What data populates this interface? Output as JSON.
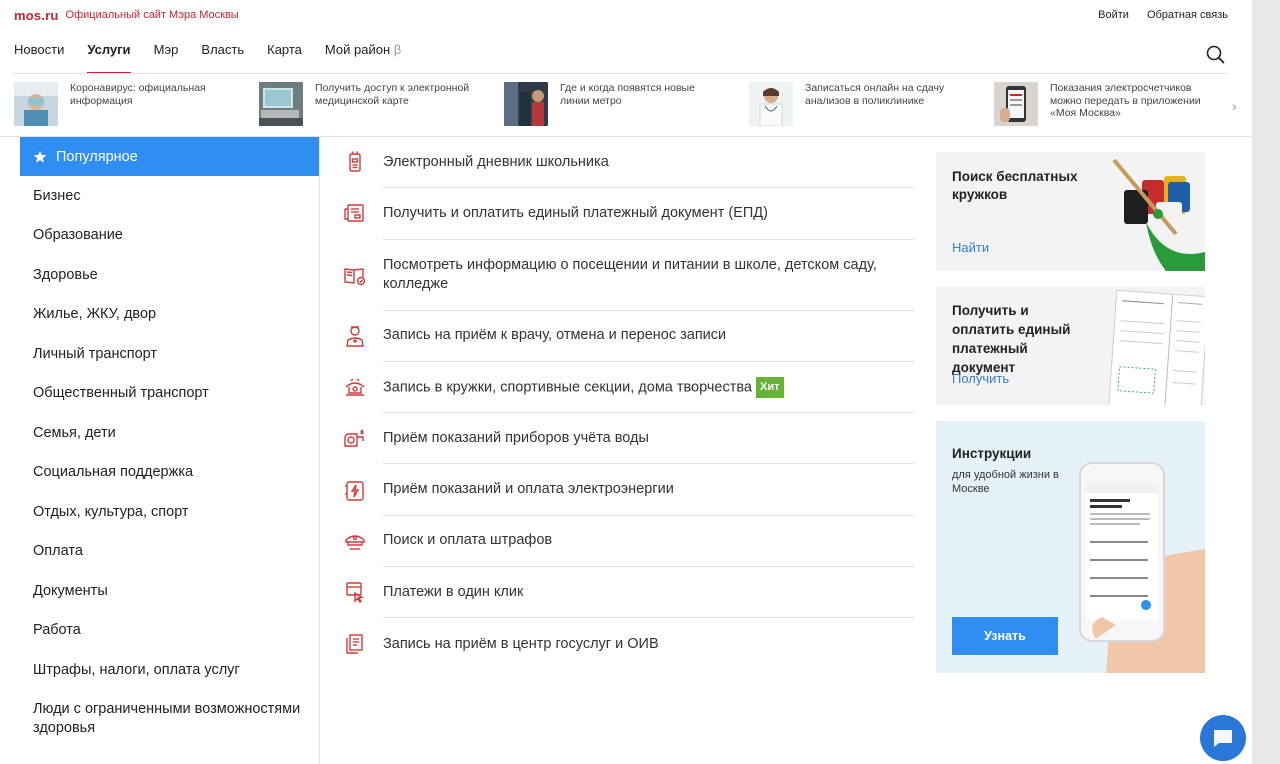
{
  "header": {
    "logo": "mos.ru",
    "tagline": "Официальный сайт Мэра Москвы",
    "login": "Войти",
    "feedback": "Обратная связь"
  },
  "nav": {
    "items": [
      {
        "label": "Новости"
      },
      {
        "label": "Услуги"
      },
      {
        "label": "Мэр"
      },
      {
        "label": "Власть"
      },
      {
        "label": "Карта"
      },
      {
        "label": "Мой район"
      }
    ],
    "beta": "β",
    "active": "Услуги"
  },
  "news": [
    {
      "text": "Коронавирус: официальная информация"
    },
    {
      "text": "Получить доступ к электронной медицинской карте"
    },
    {
      "text": "Где и когда появятся новые линии метро"
    },
    {
      "text": "Записаться онлайн на сдачу анализов в поликлинике"
    },
    {
      "text": "Показания электросчетчиков можно передать в приложении «Моя Москва»"
    }
  ],
  "sidebar": {
    "items": [
      {
        "label": "Популярное"
      },
      {
        "label": "Бизнес"
      },
      {
        "label": "Образование"
      },
      {
        "label": "Здоровье"
      },
      {
        "label": "Жилье, ЖКУ, двор"
      },
      {
        "label": "Личный транспорт"
      },
      {
        "label": "Общественный транспорт"
      },
      {
        "label": "Семья, дети"
      },
      {
        "label": "Социальная поддержка"
      },
      {
        "label": "Отдых, культура, спорт"
      },
      {
        "label": "Оплата"
      },
      {
        "label": "Документы"
      },
      {
        "label": "Работа"
      },
      {
        "label": "Штрафы, налоги, оплата услуг"
      },
      {
        "label": "Люди с ограниченными возможностями здоровья"
      }
    ]
  },
  "services": [
    {
      "label": "Электронный дневник школьника",
      "icon": "school-diary-icon"
    },
    {
      "label": "Получить и оплатить единый платежный документ (ЕПД)",
      "icon": "payment-document-icon"
    },
    {
      "label": "Посмотреть информацию о посещении и питании в школе, детском саду, колледже",
      "icon": "book-icon"
    },
    {
      "label": "Запись на приём к врачу, отмена и перенос записи",
      "icon": "doctor-icon"
    },
    {
      "label": "Запись в кружки, спортивные секции, дома творчества",
      "icon": "clubs-icon",
      "badge": "Хит"
    },
    {
      "label": "Приём показаний приборов учёта воды",
      "icon": "water-meter-icon"
    },
    {
      "label": "Приём показаний и оплата электроэнергии",
      "icon": "electricity-icon"
    },
    {
      "label": "Поиск и оплата штрафов",
      "icon": "police-cap-icon"
    },
    {
      "label": "Платежи в один клик",
      "icon": "one-click-payment-icon"
    },
    {
      "label": "Запись на приём в центр госуслуг и ОИВ",
      "icon": "documents-icon"
    }
  ],
  "cards": {
    "clubs": {
      "title": "Поиск бесплатных кружков",
      "link": "Найти"
    },
    "epd": {
      "title": "Получить и оплатить единый платежный документ",
      "link": "Получить"
    },
    "guides": {
      "title": "Инструкции",
      "subtitle": "для удобной жизни в Москве",
      "button": "Узнать"
    }
  },
  "colors": {
    "brand_red": "#cc2233",
    "accent_blue": "#2e8ef2",
    "hit_green": "#67b33a",
    "icon_red": "#d23a3a"
  }
}
